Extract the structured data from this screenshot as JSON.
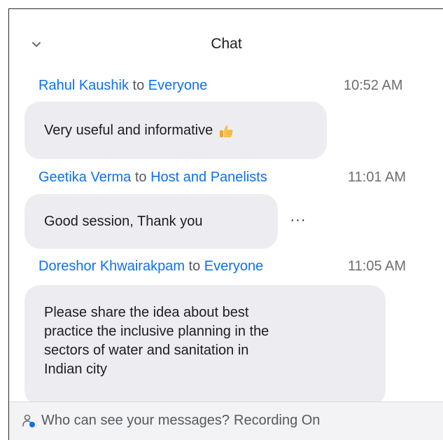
{
  "header": {
    "title": "Chat",
    "collapse_icon": "chevron-down-icon"
  },
  "messages": [
    {
      "sender": "Rahul Kaushik",
      "to": "to",
      "recipient": "Everyone",
      "time": "10:52 AM",
      "text": "Very useful and informative",
      "emoji": "thumbs-up-icon"
    },
    {
      "sender": "Geetika Verma",
      "to": "to",
      "recipient": "Host and Panelists",
      "time": "11:01 AM",
      "text": "Good session, Thank you",
      "more": "···"
    },
    {
      "sender": "Doreshor Khwairakpam",
      "to": "to",
      "recipient": "Everyone",
      "time": "11:05 AM",
      "lines": [
        "Please share the idea about best",
        "practice the inclusive planning in the",
        "sectors of water and sanitation in",
        "Indian city"
      ]
    }
  ],
  "footer": {
    "visibility_text": "Who can see your messages?",
    "recording_status": "Recording On",
    "icon": "person-visibility-icon"
  },
  "colors": {
    "accent": "#0e71eb",
    "bubble": "#ededf1",
    "footer_bg": "#f3f3f5"
  }
}
